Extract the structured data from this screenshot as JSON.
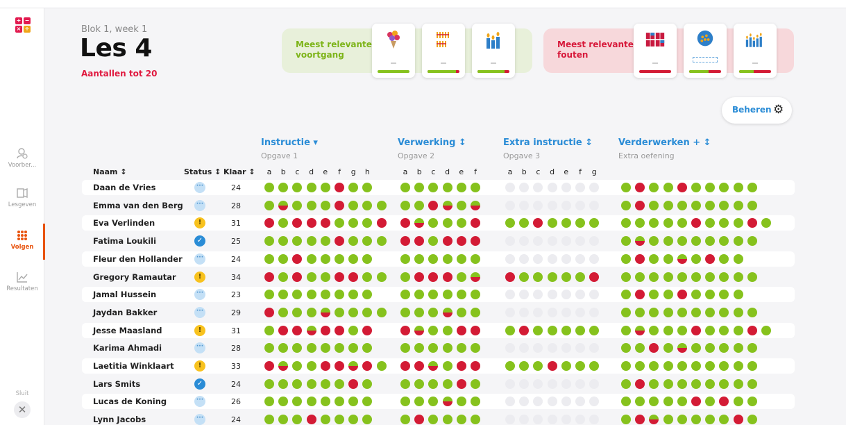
{
  "sidebar": {
    "items": [
      {
        "label": "Voorber..."
      },
      {
        "label": "Lesgeven"
      },
      {
        "label": "Volgen"
      },
      {
        "label": "Resultaten"
      }
    ],
    "close_label": "Sluit"
  },
  "lesson": {
    "block_week": "Blok 1, week 1",
    "title": "Les 4",
    "subject": "Aantallen tot 20"
  },
  "progress_panel": {
    "title": "Meest relevante voortgang",
    "cards": [
      {
        "icon": "flower-bouquet-icon",
        "progress": 1.0
      },
      {
        "icon": "bundled-sticks-icon",
        "progress": 0.9
      },
      {
        "icon": "candles-icon",
        "progress": 0.85
      }
    ]
  },
  "errors_panel": {
    "title": "Meest relevante fouten",
    "cards": [
      {
        "icon": "blocks-icon",
        "progress": 0.0
      },
      {
        "icon": "beads-jar-icon",
        "progress": 0.6
      },
      {
        "icon": "candles-many-icon",
        "progress": 0.45
      }
    ]
  },
  "manage_label": "Beheren",
  "sections": [
    {
      "title": "Instructie ▾",
      "subtitle": "Opgave 1",
      "letters": [
        "a",
        "b",
        "c",
        "d",
        "e",
        "f",
        "g",
        "h"
      ]
    },
    {
      "title": "Verwerking ↕",
      "subtitle": "Opgave 2",
      "letters": [
        "a",
        "b",
        "c",
        "d",
        "e",
        "f"
      ]
    },
    {
      "title": "Extra instructie ↕",
      "subtitle": "Opgave 3",
      "letters": [
        "a",
        "b",
        "c",
        "d",
        "e",
        "f",
        "g"
      ]
    },
    {
      "title": "Verderwerken + ↕",
      "subtitle": "Extra oefening",
      "letters": []
    }
  ],
  "columns": {
    "name": "Naam ↕",
    "status": "Status ↕",
    "done": "Klaar ↕"
  },
  "colors": {
    "correct": "#86c21d",
    "wrong": "#d31b35",
    "empty": "#ececf0",
    "accent": "#2a8cd6",
    "active_nav": "#e8530e"
  },
  "students": [
    {
      "name": "Daan de Vries",
      "status": "busy",
      "done": "24",
      "s1": "gggggrgg",
      "s2": "gggggg",
      "s3": "eeeeeee",
      "s4": "grggrggggg"
    },
    {
      "name": "Emma van den Berg",
      "status": "busy",
      "done": "28",
      "s1": "ghgggrggg",
      "s2": "ggrhgh",
      "s3": "eeeeeee",
      "s4": "grgggggggg"
    },
    {
      "name": "Eva Verlinden",
      "status": "warning",
      "done": "31",
      "s1": "rgrrrgggr",
      "s2": "rhgggr",
      "s3": "ggrgggg",
      "s4": "gggggrgggrg"
    },
    {
      "name": "Fatima Loukili",
      "status": "done",
      "done": "25",
      "s1": "gggggrggg",
      "s2": "rrgrrr",
      "s3": "eeeeeee",
      "s4": "ghgggggggg"
    },
    {
      "name": "Fleur den Hollander",
      "status": "busy",
      "done": "24",
      "s1": "ggrggggg",
      "s2": "gggggg",
      "s3": "eeeeeee",
      "s4": "grgghgrgg"
    },
    {
      "name": "Gregory Ramautar",
      "status": "warning",
      "done": "34",
      "s1": "rgrggrrgg",
      "s2": "grrrgh",
      "s3": "rgggggr",
      "s4": "gggggggggg"
    },
    {
      "name": "Jamal Hussein",
      "status": "busy",
      "done": "23",
      "s1": "gggggggg",
      "s2": "gggggg",
      "s3": "eeeeeee",
      "s4": "grggrgggg"
    },
    {
      "name": "Jaydan Bakker",
      "status": "busy",
      "done": "29",
      "s1": "rggghgggg",
      "s2": "ggghgg",
      "s3": "eeeeeee",
      "s4": "gggggggggg"
    },
    {
      "name": "Jesse Maasland",
      "status": "warning",
      "done": "31",
      "s1": "grrhrrgr",
      "s2": "rhggrr",
      "s3": "grggggg",
      "s4": "ghgggrgggrg"
    },
    {
      "name": "Karima Ahmadi",
      "status": "busy",
      "done": "28",
      "s1": "gggggggg",
      "s2": "gggggg",
      "s3": "eeeeeee",
      "s4": "ggrghggggg"
    },
    {
      "name": "Laetitia Winklaart",
      "status": "warning",
      "done": "33",
      "s1": "rhggrrhrg",
      "s2": "rrhgrr",
      "s3": "gggrggg",
      "s4": "gggggggggg"
    },
    {
      "name": "Lars Smits",
      "status": "done",
      "done": "24",
      "s1": "ggggggrg",
      "s2": "ggggrg",
      "s3": "eeeeeee",
      "s4": "grgggggggg"
    },
    {
      "name": "Lucas de Koning",
      "status": "busy",
      "done": "26",
      "s1": "gggggggg",
      "s2": "ggghgg",
      "s3": "eeeeeee",
      "s4": "gggggrgrgg"
    },
    {
      "name": "Lynn Jacobs",
      "status": "busy",
      "done": "24",
      "s1": "gggrgggg",
      "s2": "grgggg",
      "s3": "eeeeeee",
      "s4": "grhgggggrg"
    }
  ]
}
